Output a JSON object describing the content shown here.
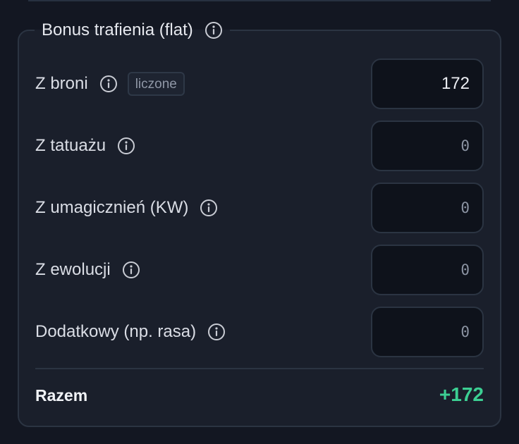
{
  "section": {
    "title": "Bonus trafienia (flat)",
    "info_icon": "info-circle-icon"
  },
  "rows": [
    {
      "label": "Z broni",
      "badge": "liczone",
      "value": "172",
      "info_icon": "info-circle-icon"
    },
    {
      "label": "Z tatuażu",
      "value": "0",
      "info_icon": "info-circle-icon"
    },
    {
      "label": "Z umagicznień (KW)",
      "value": "0",
      "info_icon": "info-circle-icon"
    },
    {
      "label": "Z ewolucji",
      "value": "0",
      "info_icon": "info-circle-icon"
    },
    {
      "label": "Dodatkowy (np. rasa)",
      "value": "0",
      "info_icon": "info-circle-icon"
    }
  ],
  "total": {
    "label": "Razem",
    "value": "+172"
  },
  "colors": {
    "background": "#131722",
    "panel": "#1a1f2b",
    "border": "#2b3442",
    "input_bg": "#0e121b",
    "accent_positive": "#3ccf93"
  }
}
